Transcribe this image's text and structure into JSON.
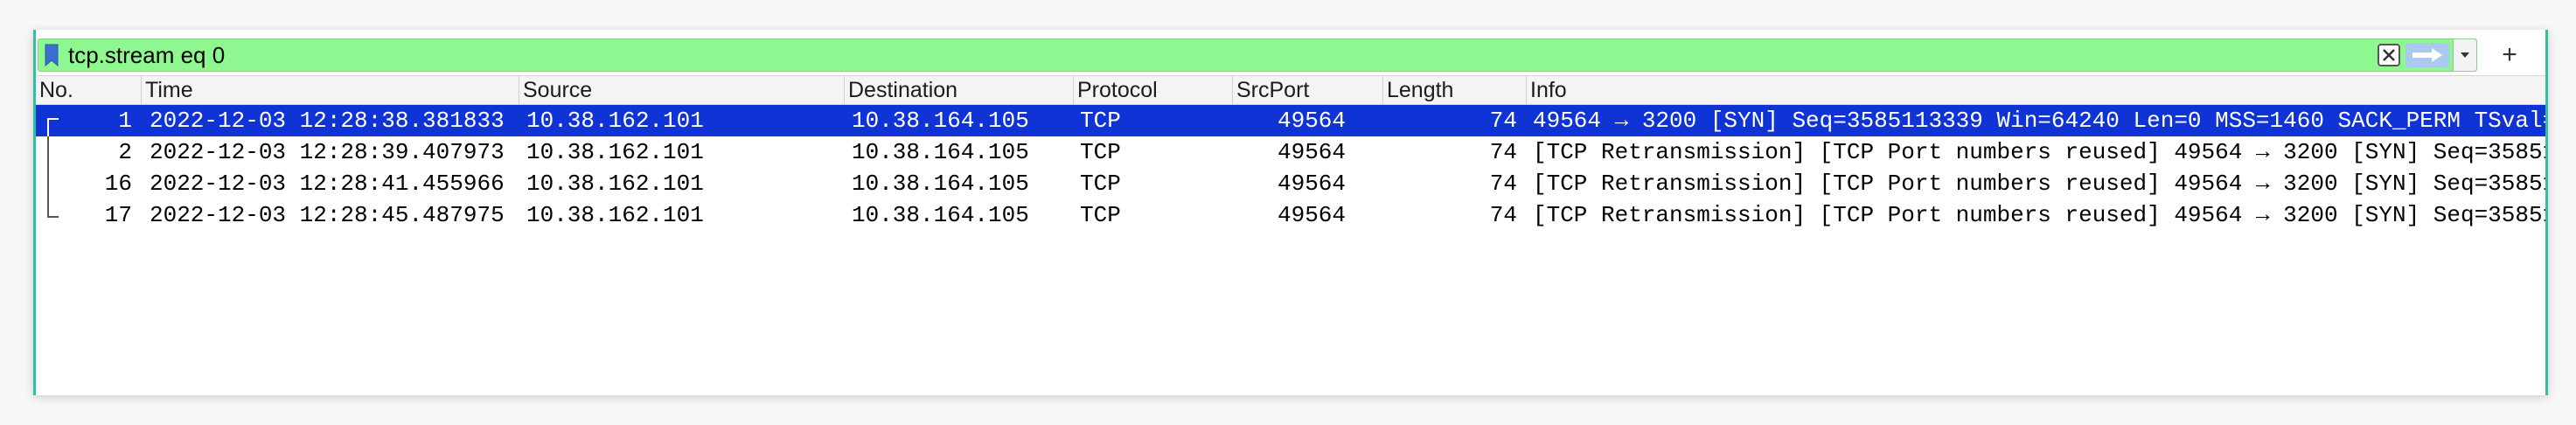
{
  "filter": {
    "text": "tcp.stream eq 0",
    "add_label": "+"
  },
  "columns": [
    "No.",
    "Time",
    "Source",
    "Destination",
    "Protocol",
    "SrcPort",
    "Length",
    "Info"
  ],
  "packets": [
    {
      "no": "1",
      "time": "2022-12-03 12:28:38.381833",
      "source": "10.38.162.101",
      "destination": "10.38.164.105",
      "protocol": "TCP",
      "srcport": "49564",
      "length": "74",
      "info": "49564 → 3200 [SYN] Seq=3585113339 Win=64240 Len=0 MSS=1460 SACK_PERM TSval=",
      "selected": true
    },
    {
      "no": "2",
      "time": "2022-12-03 12:28:39.407973",
      "source": "10.38.162.101",
      "destination": "10.38.164.105",
      "protocol": "TCP",
      "srcport": "49564",
      "length": "74",
      "info": "[TCP Retransmission] [TCP Port numbers reused] 49564 → 3200 [SYN] Seq=35851",
      "selected": false
    },
    {
      "no": "16",
      "time": "2022-12-03 12:28:41.455966",
      "source": "10.38.162.101",
      "destination": "10.38.164.105",
      "protocol": "TCP",
      "srcport": "49564",
      "length": "74",
      "info": "[TCP Retransmission] [TCP Port numbers reused] 49564 → 3200 [SYN] Seq=35851",
      "selected": false
    },
    {
      "no": "17",
      "time": "2022-12-03 12:28:45.487975",
      "source": "10.38.162.101",
      "destination": "10.38.164.105",
      "protocol": "TCP",
      "srcport": "49564",
      "length": "74",
      "info": "[TCP Retransmission] [TCP Port numbers reused] 49564 → 3200 [SYN] Seq=35851",
      "selected": false
    }
  ],
  "colors": {
    "filter_valid": "#8ff78f",
    "selection": "#1033d6",
    "window_accent": "#2fc2a0"
  }
}
